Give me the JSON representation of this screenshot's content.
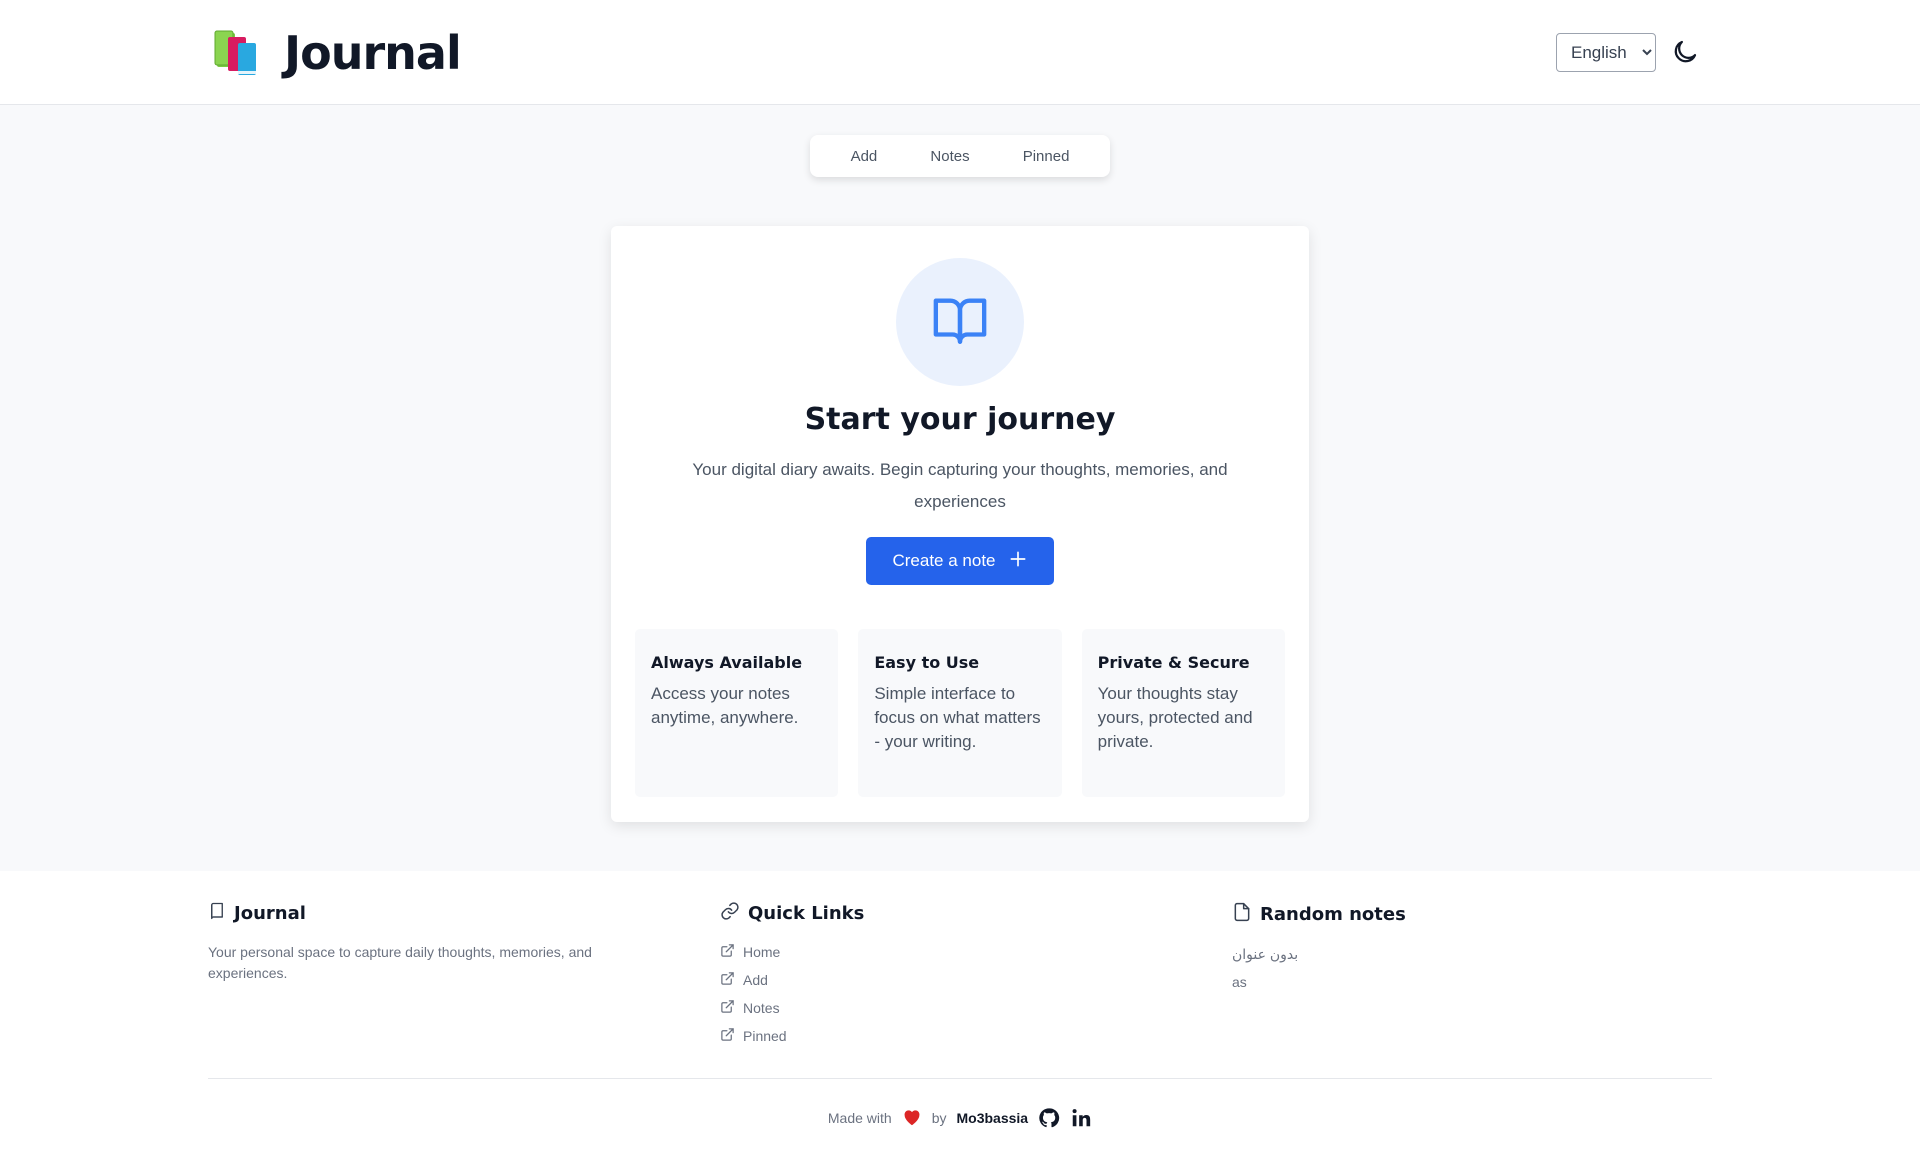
{
  "header": {
    "app_title": "Journal",
    "language_selected": "English",
    "language_options": [
      "English"
    ]
  },
  "tabs": [
    {
      "label": "Add"
    },
    {
      "label": "Notes"
    },
    {
      "label": "Pinned"
    }
  ],
  "hero": {
    "title": "Start your journey",
    "subtitle": "Your digital diary awaits. Begin capturing your thoughts, memories, and experiences",
    "cta_label": "Create a note"
  },
  "features": [
    {
      "title": "Always Available",
      "text": "Access your notes anytime, anywhere."
    },
    {
      "title": "Easy to Use",
      "text": "Simple interface to focus on what matters - your writing."
    },
    {
      "title": "Private & Secure",
      "text": "Your thoughts stay yours, protected and private."
    }
  ],
  "footer": {
    "about": {
      "title": "Journal",
      "description": "Your personal space to capture daily thoughts, memories, and experiences."
    },
    "quick_links": {
      "title": "Quick Links",
      "items": [
        "Home",
        "Add",
        "Notes",
        "Pinned"
      ]
    },
    "random_notes": {
      "title": "Random notes",
      "items": [
        "بدون عنوان",
        "as"
      ]
    },
    "made_with": "Made with",
    "by": "by",
    "author": "Mo3bassia"
  },
  "colors": {
    "accent": "#2563eb",
    "heart": "#dc2626",
    "hero_circle": "#eaf1fd"
  }
}
